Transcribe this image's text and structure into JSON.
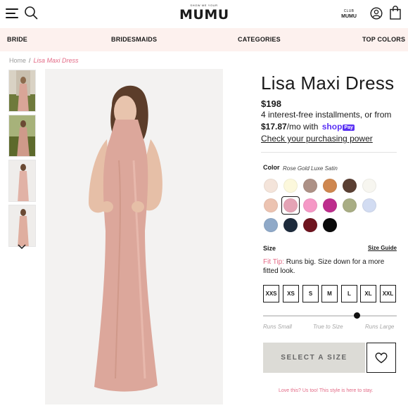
{
  "header": {
    "logo_small": "SHOW ME YOUR",
    "logo_main": "MUMU",
    "club_small": "CLUB",
    "club_main": "MUMU",
    "icons": [
      "menu-icon",
      "search-icon",
      "account-icon",
      "shopping-bag-icon"
    ]
  },
  "nav": {
    "items": [
      {
        "label": "BRIDE"
      },
      {
        "label": "BRIDESMAIDS"
      },
      {
        "label": "CATEGORIES"
      },
      {
        "label": "TOP COLORS"
      }
    ]
  },
  "breadcrumb": {
    "home": "Home",
    "separator": "/",
    "current": "Lisa Maxi Dress"
  },
  "product": {
    "title": "Lisa Maxi Dress",
    "price": "$198",
    "installments_line1": "4 interest-free installments, or from",
    "installment_amount": "$17.87",
    "installment_suffix": "/mo with",
    "shop_word": "shop",
    "pay_word": "Pay",
    "check_link": "Check your purchasing power"
  },
  "color": {
    "label": "Color",
    "selected_name": "Rose Gold Luxe Satin",
    "selected_index": 7,
    "swatches": [
      "#f4e4da",
      "#fcf8dc",
      "#ad9186",
      "#cf874f",
      "#5a3f33",
      "#f7f6f0",
      "#ecc3b1",
      "#e4a3b5",
      "#f598c6",
      "#bd2e8d",
      "#a8ad84",
      "#d2dcf2",
      "#8fa9c8",
      "#1d2b3c",
      "#6e141f",
      "#0a0a0a"
    ]
  },
  "size": {
    "label": "Size",
    "guide_link": "Size Guide",
    "fit_tip_label": "Fit Tip:",
    "fit_tip_text": "Runs big. Size down for a more fitted look.",
    "options": [
      "XXS",
      "XS",
      "S",
      "M",
      "L",
      "XL",
      "XXL"
    ],
    "fit_scale": {
      "labels": [
        "Runs Small",
        "True to Size",
        "Runs Large"
      ],
      "position": 0.7
    }
  },
  "actions": {
    "select_size": "SELECT A SIZE"
  },
  "footer_note": "Love this? Us too! This style is here to stay.",
  "colors": {
    "accent_pink": "#e36a86",
    "nav_bg": "#fdf1ee",
    "shop_pay": "#5a31f4",
    "button_bg": "#dcdbd6"
  }
}
